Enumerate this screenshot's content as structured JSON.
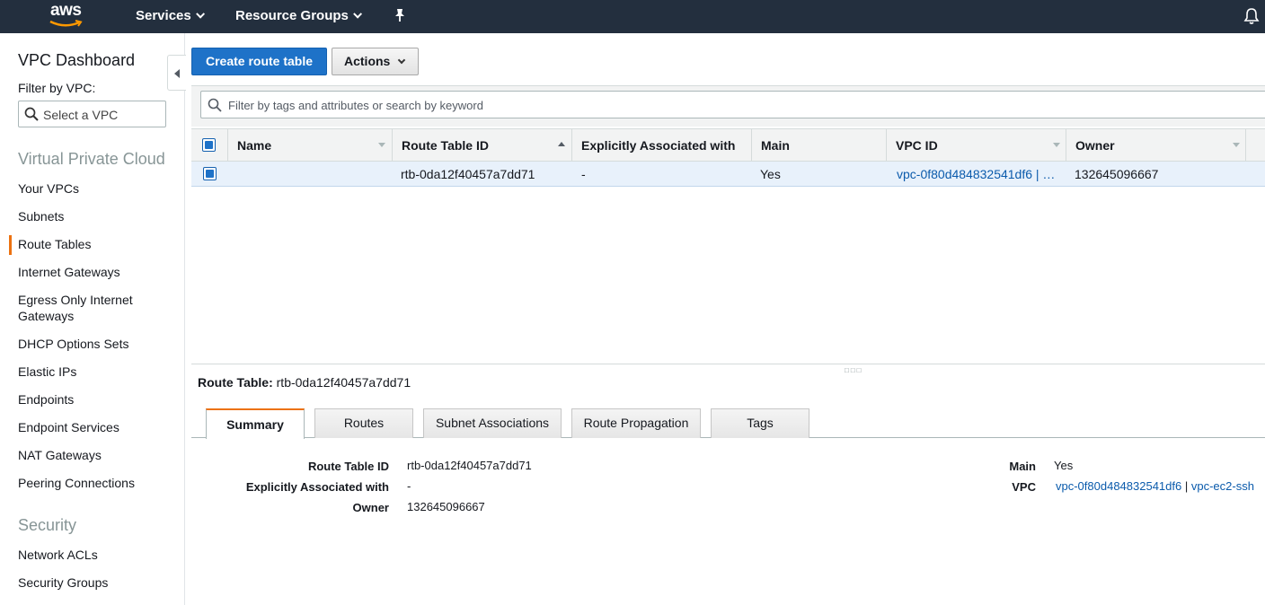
{
  "topnav": {
    "logo_text": "aws",
    "services": "Services",
    "resource_groups": "Resource Groups"
  },
  "sidebar": {
    "title": "VPC Dashboard",
    "filter_label": "Filter by VPC:",
    "filter_placeholder": "Select a VPC",
    "sections": [
      {
        "heading": "Virtual Private Cloud",
        "items": [
          "Your VPCs",
          "Subnets",
          "Route Tables",
          "Internet Gateways",
          "Egress Only Internet Gateways",
          "DHCP Options Sets",
          "Elastic IPs",
          "Endpoints",
          "Endpoint Services",
          "NAT Gateways",
          "Peering Connections"
        ]
      },
      {
        "heading": "Security",
        "items": [
          "Network ACLs",
          "Security Groups"
        ]
      }
    ],
    "active_item": "Route Tables"
  },
  "toolbar": {
    "create_label": "Create route table",
    "actions_label": "Actions"
  },
  "table": {
    "filter_placeholder": "Filter by tags and attributes or search by keyword",
    "columns": [
      "Name",
      "Route Table ID",
      "Explicitly Associated with",
      "Main",
      "VPC ID",
      "Owner"
    ],
    "rows": [
      {
        "name": "",
        "route_table_id": "rtb-0da12f40457a7dd71",
        "explicitly_associated": "-",
        "main": "Yes",
        "vpc_id": "vpc-0f80d484832541df6 | …",
        "owner": "132645096667"
      }
    ]
  },
  "details": {
    "title_label": "Route Table:",
    "title_value": "rtb-0da12f40457a7dd71",
    "tabs": [
      "Summary",
      "Routes",
      "Subnet Associations",
      "Route Propagation",
      "Tags"
    ],
    "active_tab": "Summary",
    "fields_left": [
      {
        "label": "Route Table ID",
        "value": "rtb-0da12f40457a7dd71"
      },
      {
        "label": "Explicitly Associated with",
        "value": "-"
      },
      {
        "label": "Owner",
        "value": "132645096667"
      }
    ],
    "fields_right": [
      {
        "label": "Main",
        "value": "Yes"
      },
      {
        "label": "VPC",
        "value_link1": "vpc-0f80d484832541df6",
        "separator": "|",
        "value_link2": "vpc-ec2-ssh"
      }
    ]
  },
  "colors": {
    "nav_bg": "#232f3e",
    "primary": "#1e72c8",
    "accent": "#ec7211",
    "link": "#0b5bac"
  }
}
